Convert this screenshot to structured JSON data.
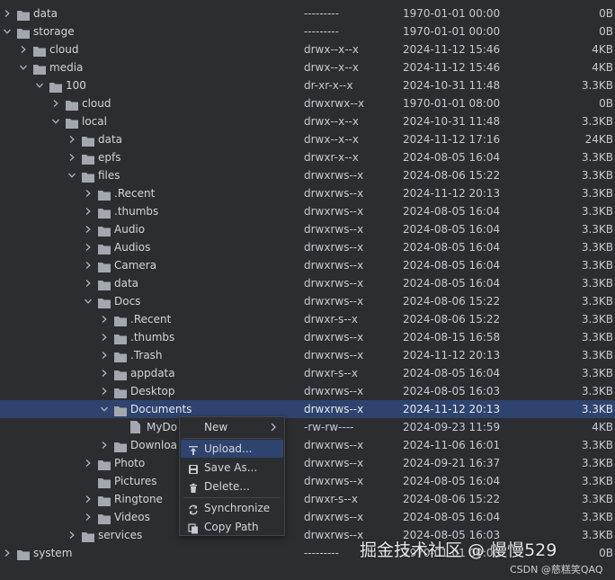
{
  "colors": {
    "background": "#2b2d30",
    "selection": "#2e436e",
    "folder": "#a3a7b0",
    "text": "#c7cad1"
  },
  "tree": {
    "rows": [
      {
        "name": "data",
        "perm": "---------",
        "date": "1970-01-01 00:00",
        "size": "0B",
        "expanded": false,
        "type": "folder"
      },
      {
        "name": "storage",
        "perm": "---------",
        "date": "1970-01-01 00:00",
        "size": "0B",
        "expanded": true,
        "type": "folder"
      },
      {
        "name": "cloud",
        "perm": "drwx--x--x",
        "date": "2024-11-12 15:46",
        "size": "4KB",
        "expanded": false,
        "type": "folder"
      },
      {
        "name": "media",
        "perm": "drwx--x--x",
        "date": "2024-11-12 15:46",
        "size": "4KB",
        "expanded": true,
        "type": "folder"
      },
      {
        "name": "100",
        "perm": "dr-xr-x--x",
        "date": "2024-10-31 11:48",
        "size": "3.3KB",
        "expanded": true,
        "type": "folder"
      },
      {
        "name": "cloud",
        "perm": "drwxrwx--x",
        "date": "1970-01-01 08:00",
        "size": "0B",
        "expanded": false,
        "type": "folder"
      },
      {
        "name": "local",
        "perm": "drwx--x--x",
        "date": "2024-10-31 11:48",
        "size": "3.3KB",
        "expanded": true,
        "type": "folder"
      },
      {
        "name": "data",
        "perm": "drwx--x--x",
        "date": "2024-11-12 17:16",
        "size": "24KB",
        "expanded": false,
        "type": "folder"
      },
      {
        "name": "epfs",
        "perm": "drwxr-x--x",
        "date": "2024-08-05 16:04",
        "size": "3.3KB",
        "expanded": false,
        "type": "folder"
      },
      {
        "name": "files",
        "perm": "drwxrws--x",
        "date": "2024-08-06 15:22",
        "size": "3.3KB",
        "expanded": true,
        "type": "folder"
      },
      {
        "name": ".Recent",
        "perm": "drwxrws--x",
        "date": "2024-11-12 20:13",
        "size": "3.3KB",
        "expanded": false,
        "type": "folder"
      },
      {
        "name": ".thumbs",
        "perm": "drwxrws--x",
        "date": "2024-08-05 16:04",
        "size": "3.3KB",
        "expanded": false,
        "type": "folder"
      },
      {
        "name": "Audio",
        "perm": "drwxrws--x",
        "date": "2024-08-05 16:04",
        "size": "3.3KB",
        "expanded": false,
        "type": "folder"
      },
      {
        "name": "Audios",
        "perm": "drwxrws--x",
        "date": "2024-08-05 16:04",
        "size": "3.3KB",
        "expanded": false,
        "type": "folder"
      },
      {
        "name": "Camera",
        "perm": "drwxrws--x",
        "date": "2024-08-05 16:04",
        "size": "3.3KB",
        "expanded": false,
        "type": "folder"
      },
      {
        "name": "data",
        "perm": "drwxrws--x",
        "date": "2024-08-05 16:04",
        "size": "3.3KB",
        "expanded": false,
        "type": "folder"
      },
      {
        "name": "Docs",
        "perm": "drwxrws--x",
        "date": "2024-08-06 15:22",
        "size": "3.3KB",
        "expanded": true,
        "type": "folder"
      },
      {
        "name": ".Recent",
        "perm": "drwxr-s--x",
        "date": "2024-08-06 15:22",
        "size": "3.3KB",
        "expanded": false,
        "type": "folder"
      },
      {
        "name": ".thumbs",
        "perm": "drwxrws--x",
        "date": "2024-08-15 16:58",
        "size": "3.3KB",
        "expanded": false,
        "type": "folder"
      },
      {
        "name": ".Trash",
        "perm": "drwxrws--x",
        "date": "2024-11-12 20:13",
        "size": "3.3KB",
        "expanded": false,
        "type": "folder"
      },
      {
        "name": "appdata",
        "perm": "drwxr-s--x",
        "date": "2024-08-05 16:04",
        "size": "3.3KB",
        "expanded": false,
        "type": "folder"
      },
      {
        "name": "Desktop",
        "perm": "drwxrws--x",
        "date": "2024-08-05 16:03",
        "size": "3.3KB",
        "expanded": false,
        "type": "folder"
      },
      {
        "name": "Documents",
        "perm": "drwxrws--x",
        "date": "2024-11-12 20:13",
        "size": "3.3KB",
        "expanded": true,
        "type": "folder",
        "selected": true
      },
      {
        "name": "MyDo",
        "perm": "-rw-rw----",
        "date": "2024-09-23 11:59",
        "size": "4KB",
        "type": "file"
      },
      {
        "name": "Downloa",
        "perm": "drwxrws--x",
        "date": "2024-11-06 16:01",
        "size": "3.3KB",
        "expanded": false,
        "type": "folder"
      },
      {
        "name": "Photo",
        "perm": "drwxrws--x",
        "date": "2024-09-21 16:37",
        "size": "3.3KB",
        "expanded": false,
        "type": "folder"
      },
      {
        "name": "Pictures",
        "perm": "drwxrws--x",
        "date": "2024-08-05 16:04",
        "size": "3.3KB",
        "expanded": false,
        "type": "folder"
      },
      {
        "name": "Ringtone",
        "perm": "drwxr-s--x",
        "date": "2024-08-06 15:22",
        "size": "3.3KB",
        "expanded": false,
        "type": "folder"
      },
      {
        "name": "Videos",
        "perm": "drwxrws--x",
        "date": "2024-08-05 16:04",
        "size": "3.3KB",
        "expanded": false,
        "type": "folder"
      },
      {
        "name": "services",
        "perm": "drwxrws--x",
        "date": "2024-08-05 16:03",
        "size": "3.3KB",
        "expanded": false,
        "type": "folder"
      },
      {
        "name": "system",
        "perm": "---------",
        "date": "1970-01-01 00:00",
        "size": "0B",
        "expanded": false,
        "type": "folder"
      }
    ]
  },
  "context_menu": {
    "items": [
      {
        "label": "New",
        "icon": "none",
        "submenu": true
      },
      {
        "label": "Upload...",
        "icon": "upload-icon",
        "active": true
      },
      {
        "label": "Save As...",
        "icon": "save-icon"
      },
      {
        "label": "Delete...",
        "icon": "trash-icon"
      },
      {
        "label": "Synchronize",
        "icon": "sync-icon"
      },
      {
        "label": "Copy Path",
        "icon": "copy-icon"
      }
    ]
  },
  "watermark": {
    "main": "掘金技术社区 @ 慢慢529",
    "sub": "CSDN @慈糕笑QAQ"
  }
}
